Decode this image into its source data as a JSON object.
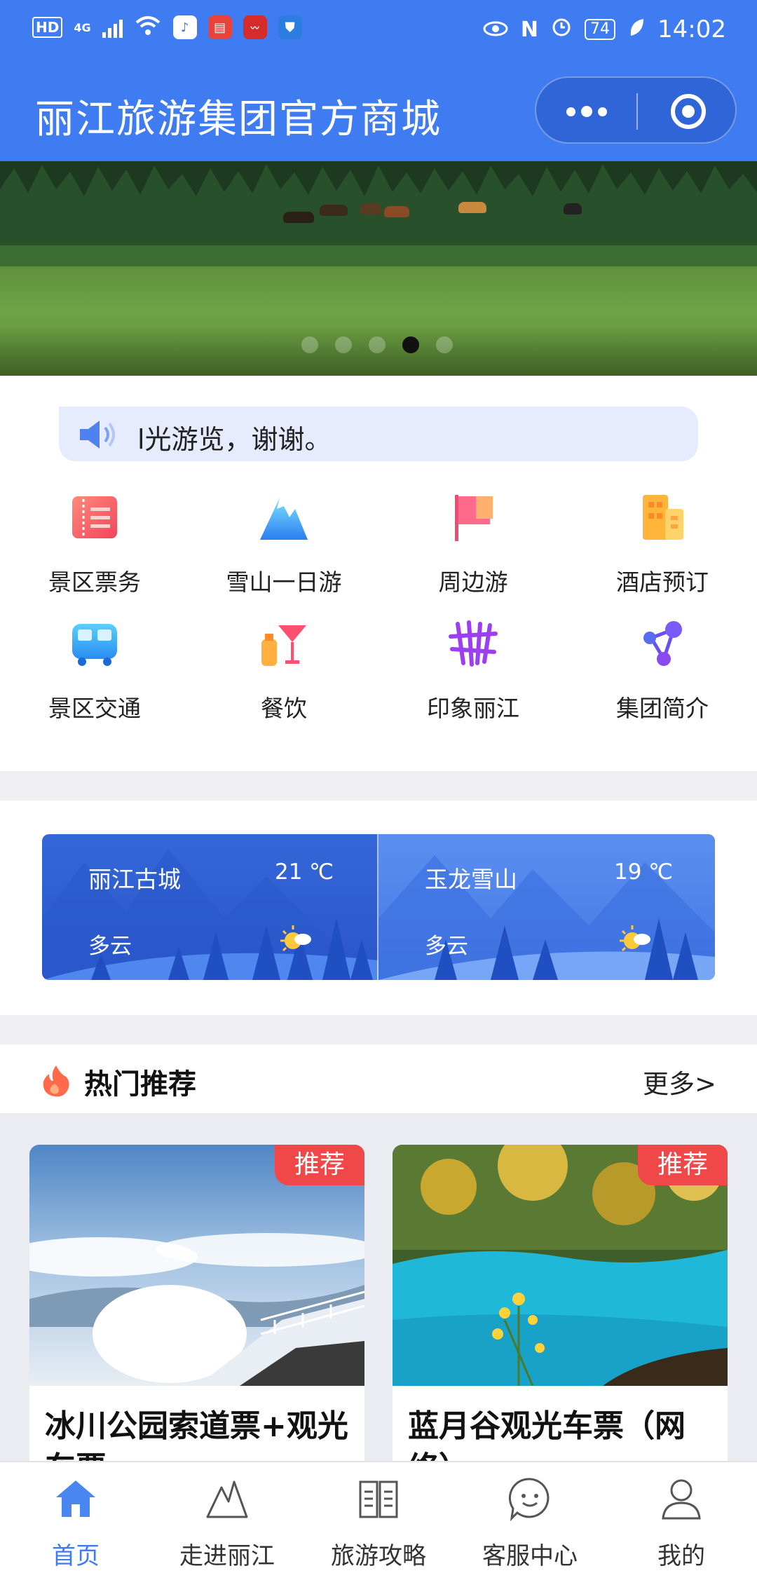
{
  "status_bar": {
    "hd": "HD",
    "network": "4G",
    "battery": "74",
    "time": "14:02"
  },
  "header": {
    "title": "丽江旅游集团官方商城"
  },
  "banner": {
    "slide_count": 5,
    "active_slide": 4
  },
  "notice": {
    "text": "l光游览，谢谢。"
  },
  "grid": {
    "items": [
      {
        "label": "景区票务",
        "icon": "ticket-icon"
      },
      {
        "label": "雪山一日游",
        "icon": "mountain-icon"
      },
      {
        "label": "周边游",
        "icon": "flag-icon"
      },
      {
        "label": "酒店预订",
        "icon": "hotel-icon"
      },
      {
        "label": "景区交通",
        "icon": "bus-icon"
      },
      {
        "label": "餐饮",
        "icon": "drink-icon"
      },
      {
        "label": "印象丽江",
        "icon": "impression-icon"
      },
      {
        "label": "集团简介",
        "icon": "network-icon"
      }
    ]
  },
  "weather": {
    "cities": [
      {
        "name": "丽江古城",
        "temp": "21 ℃",
        "cond": "多云",
        "icon": "partly-cloudy-icon"
      },
      {
        "name": "玉龙雪山",
        "temp": "19 ℃",
        "cond": "多云",
        "icon": "partly-cloudy-icon"
      }
    ]
  },
  "hot": {
    "title": "热门推荐",
    "more": "更多>",
    "products": [
      {
        "tag": "推荐",
        "name": "冰川公园索道票+观光车票"
      },
      {
        "tag": "推荐",
        "name": "蓝月谷观光车票（网络）"
      }
    ]
  },
  "tabbar": {
    "items": [
      {
        "label": "首页",
        "icon": "home-icon",
        "active": true
      },
      {
        "label": "走进丽江",
        "icon": "mountain-outline-icon",
        "active": false
      },
      {
        "label": "旅游攻略",
        "icon": "book-icon",
        "active": false
      },
      {
        "label": "客服中心",
        "icon": "chat-icon",
        "active": false
      },
      {
        "label": "我的",
        "icon": "user-icon",
        "active": false
      }
    ]
  },
  "colors": {
    "brand": "#3f7cf1",
    "tag_red": "#f04848",
    "notice_bg": "#e6ecfd"
  }
}
